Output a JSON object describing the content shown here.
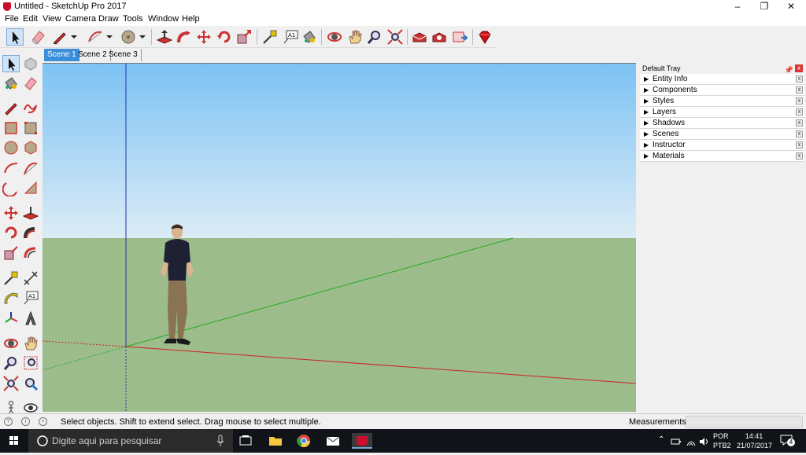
{
  "window": {
    "title": "Untitled - SketchUp Pro 2017",
    "minimize": "–",
    "restore": "❐",
    "close": "✕"
  },
  "menu": [
    "File",
    "Edit",
    "View",
    "Camera",
    "Draw",
    "Tools",
    "Window",
    "Help"
  ],
  "toolbar": {
    "icons": [
      "select-icon",
      "eraser-icon",
      "pencil-line-icon",
      "dropdown-icon",
      "arc-icon",
      "dropdown-icon",
      "circle-icon",
      "dropdown-icon",
      "push-pull-icon",
      "follow-me-icon",
      "move-icon",
      "rotate-icon",
      "scale-icon",
      "tape-measure-icon",
      "text-icon",
      "paint-bucket-icon",
      "orbit-icon",
      "pan-icon",
      "zoom-icon",
      "zoom-extents-icon",
      "warehouse-icon",
      "extension-warehouse-icon",
      "send-to-layout-icon",
      "ruby-icon"
    ]
  },
  "left_toolbar": {
    "icons": [
      "select-icon",
      "make-component-icon",
      "paint-bucket-icon",
      "eraser-icon",
      "line-icon",
      "freehand-icon",
      "rectangle-icon",
      "rotated-rectangle-icon",
      "circle-icon",
      "polygon-icon",
      "arc-icon",
      "two-point-arc-icon",
      "pie-icon",
      "three-point-arc-icon",
      "move-icon",
      "push-pull-icon",
      "rotate-icon",
      "follow-me-icon",
      "scale-icon",
      "offset-icon",
      "tape-measure-icon",
      "dimension-icon",
      "protractor-icon",
      "text-icon",
      "axes-icon",
      "3d-text-icon",
      "orbit-icon",
      "pan-icon",
      "zoom-icon",
      "zoom-window-icon",
      "zoom-extents-icon",
      "previous-view-icon",
      "position-camera-icon",
      "look-around-icon"
    ]
  },
  "scenes": [
    {
      "label": "Scene 1",
      "active": true
    },
    {
      "label": "Scene 2",
      "active": false
    },
    {
      "label": "Scene 3",
      "active": false
    }
  ],
  "tray": {
    "title": "Default Tray",
    "pin": "📌",
    "close": "x",
    "panels": [
      "Entity Info",
      "Components",
      "Styles",
      "Layers",
      "Shadows",
      "Scenes",
      "Instructor",
      "Materials"
    ],
    "panel_close": "x"
  },
  "statusbar": {
    "hint": "Select objects. Shift to extend select. Drag mouse to select multiple.",
    "measurements_label": "Measurements",
    "measurements_value": ""
  },
  "taskbar": {
    "search_placeholder": "Digite aqui para pesquisar",
    "lang_top": "POR",
    "lang_bottom": "PTB2",
    "time": "14:41",
    "date": "21/07/2017",
    "notifications": "4"
  },
  "colors": {
    "sky_top": "#7cc2f4",
    "sky_bottom": "#dcecf6",
    "ground": "#9cbc8c",
    "active_tab": "#3b8fd9",
    "axis_red": "#cc2222",
    "axis_green": "#22aa22",
    "axis_blue": "#2233aa"
  }
}
